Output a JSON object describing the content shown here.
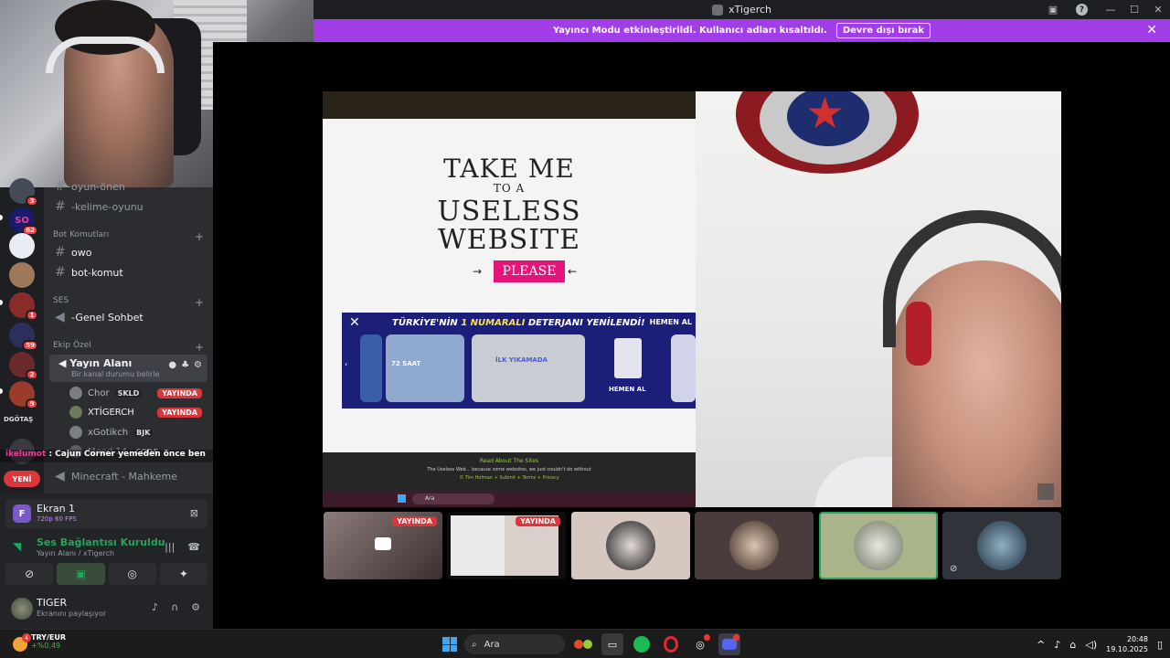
{
  "window": {
    "title": "xTigerch"
  },
  "banner": {
    "message": "Yayıncı Modu etkinleştirildi. Kullanıcı adları kısaltıldı.",
    "button": "Devre dışı bırak"
  },
  "guilds": {
    "badges": [
      "3",
      "62",
      "1",
      "59",
      "2",
      "9"
    ],
    "text_label": "DGÖTAŞ",
    "new_label": "YENİ"
  },
  "channels": {
    "partial_top": "oyun-önen",
    "kelime": "-kelime-oyunu",
    "cat_bot": "Bot Komutları",
    "owo": "owo",
    "botkomut": "bot-komut",
    "cat_ses": "SES",
    "genel": "-Genel Sohbet",
    "cat_ekip": "Ekip Özel",
    "voice_channel": "Yayın Alanı",
    "voice_status": "Bir kanal durumu belirle",
    "minecraft": "Minecraft - Mahkeme"
  },
  "voice_users": [
    {
      "name": "Chor",
      "clan": "SKLD",
      "live": "YAYINDA"
    },
    {
      "name": "XTİGERCH",
      "clan": "",
      "live": "YAYINDA"
    },
    {
      "name": "xGotikch",
      "clan": "BJK",
      "live": ""
    },
    {
      "name": "Mood 14",
      "clan": "CODE",
      "live": ""
    }
  ],
  "chat_overlay": {
    "user": "ikelumot",
    "text": ": Cajun Corner yemeden önce ben"
  },
  "panel": {
    "screen_title": "Ekran 1",
    "screen_quality": "720p 60 FPS",
    "rtc_title": "Ses Bağlantısı Kuruldu",
    "rtc_sub": "Yayın Alanı / xTigerch",
    "user_name": "TIGER",
    "user_status": "Ekranını paylaşıyor"
  },
  "stream": {
    "site_title_1": "TAKE ME",
    "site_title_2": "TO A",
    "site_title_3": "USELESS",
    "site_title_4": "WEBSITE",
    "site_please": "PLEASE",
    "ad_head_1": "TÜRKİYE'NİN",
    "ad_head_2": "1 NUMARALI",
    "ad_head_3": "DETERJANI YENİLENDİ!",
    "ad_right": "HEMEN AL",
    "ad_card_1": "72 SAAT",
    "ad_card_2": "İLK YIKAMADA",
    "ad_card_3": "HEMEN AL",
    "footer_1": "Read About The Sites",
    "footer_2": "The Useless Web... because some websites, we just couldn't do without",
    "footer_3": "© Tim Holman + Submit + Terms + Privacy",
    "mini_search": "Ara"
  },
  "thumbnails": [
    {
      "live": "YAYINDA"
    },
    {
      "live": "YAYINDA"
    }
  ],
  "taskbar": {
    "ticker_name": "TRY/EUR",
    "ticker_value": "+%0,49",
    "ticker_badge": "4",
    "search": "Ara",
    "time": "20:48",
    "date": "19.10.2025"
  }
}
